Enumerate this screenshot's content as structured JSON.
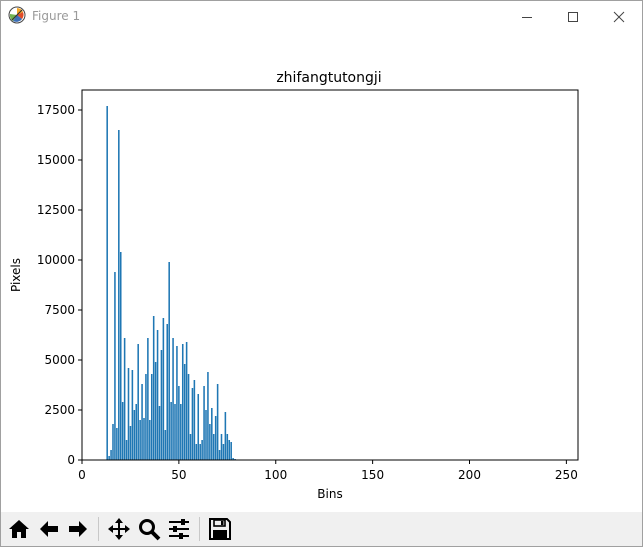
{
  "window": {
    "title": "Figure 1"
  },
  "toolbar": {
    "buttons": [
      "home-icon",
      "back-arrow-icon",
      "forward-arrow-icon",
      "pan-icon",
      "zoom-icon",
      "configure-subplots-icon",
      "save-icon"
    ]
  },
  "colors": {
    "bar": "#1f77b4",
    "toolbar_bg": "#f0f0f0"
  },
  "chart_data": {
    "type": "bar",
    "title": "zhifangtutongji",
    "xlabel": "Bins",
    "ylabel": "Pixels",
    "xlim": [
      0,
      256
    ],
    "ylim": [
      0,
      18500
    ],
    "xticks": [
      0,
      50,
      100,
      150,
      200,
      250
    ],
    "yticks": [
      0,
      2500,
      5000,
      7500,
      10000,
      12500,
      15000,
      17500
    ],
    "grid": false,
    "x": [
      13,
      14,
      15,
      16,
      17,
      18,
      19,
      20,
      21,
      22,
      23,
      24,
      25,
      26,
      27,
      28,
      29,
      30,
      31,
      32,
      33,
      34,
      35,
      36,
      37,
      38,
      39,
      40,
      41,
      42,
      43,
      44,
      45,
      46,
      47,
      48,
      49,
      50,
      51,
      52,
      53,
      54,
      55,
      56,
      57,
      58,
      59,
      60,
      61,
      62,
      63,
      64,
      65,
      66,
      67,
      68,
      69,
      70,
      71,
      72,
      73,
      74,
      75,
      76,
      77,
      78,
      79
    ],
    "values": [
      17700,
      200,
      500,
      1800,
      9400,
      1600,
      16500,
      10400,
      2900,
      6100,
      1000,
      4600,
      1700,
      4500,
      2500,
      2800,
      5800,
      2000,
      3800,
      2100,
      4300,
      6100,
      2000,
      4300,
      7200,
      4900,
      6500,
      2700,
      5500,
      7100,
      1500,
      6800,
      9900,
      2900,
      6100,
      2800,
      5700,
      3700,
      2800,
      5800,
      4800,
      5900,
      4300,
      1300,
      3600,
      4000,
      800,
      3300,
      800,
      1000,
      3700,
      2500,
      4400,
      1800,
      2600,
      1300,
      2200,
      3800,
      500,
      1300,
      800,
      2400,
      1300,
      1000,
      900,
      100,
      50
    ]
  }
}
